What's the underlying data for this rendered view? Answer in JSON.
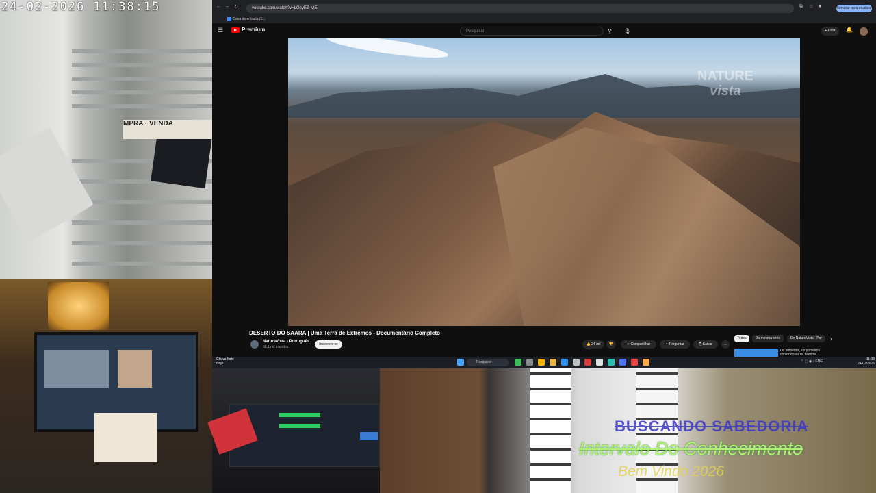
{
  "camera": {
    "timestamp": "24-02-2026 11:38:15",
    "sign_text": "MPRA · VENDA"
  },
  "overlay": {
    "line1": "BUSCANDO SABEDORIA",
    "line2": "Intervalo Do Conhecimento",
    "line3": "Bem Vindo 2026"
  },
  "browser": {
    "url": "youtube.com/watch?v=LQbyEZ_vtE",
    "bookmark": "Caixa de entrada (1...",
    "update_label": "Reiniciar para atualizar"
  },
  "youtube": {
    "logo_text": "Premium",
    "search_placeholder": "Pesquisar",
    "create_label": "+ Criar",
    "video_watermark_line1": "NATURE",
    "video_watermark_line2": "vista",
    "video_title": "DESERTO DO SAARA | Uma Terra de Extremos - Documentário Completo",
    "channel_name": "NatureVista - Português",
    "channel_subs": "68,1 mil inscritos",
    "subscribe_label": "Inscrever-se",
    "likes": "24 mil",
    "share_label": "Compartilhar",
    "ask_label": "Perguntar",
    "save_label": "Salvar",
    "more_label": "...",
    "chips": [
      "Todos",
      "Da mesma série",
      "De NatureVista - Por"
    ],
    "recommended_text": "Os sumérios, os primeiros construtores da história"
  },
  "taskbar": {
    "weather_line1": "Chuva forte",
    "weather_line2": "Hoje",
    "search_label": "Pesquisar",
    "tray_lang": "ENG",
    "clock_time": "11:38",
    "clock_date": "24/02/2026"
  }
}
